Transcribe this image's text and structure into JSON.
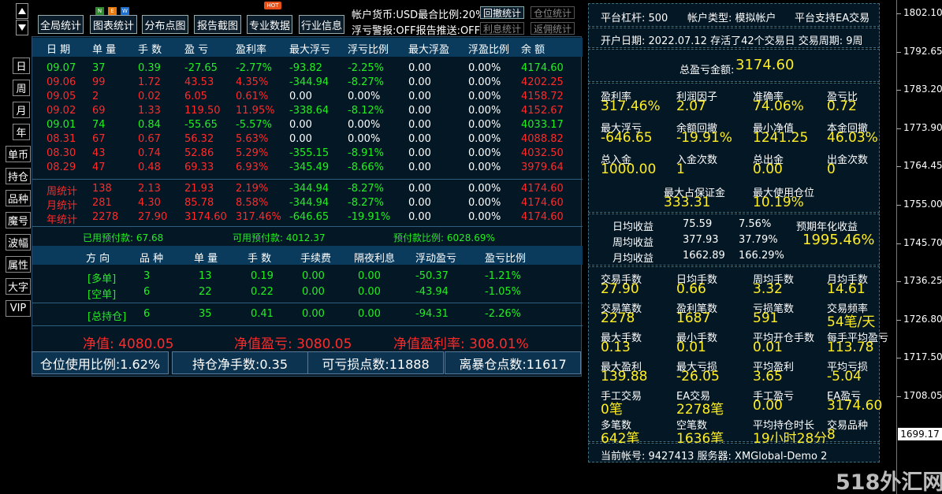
{
  "toolbar": {
    "buttons": [
      "全局统计",
      "图表统计",
      "分布点图",
      "报告截图",
      "专业数据",
      "行业信息"
    ],
    "badges": [
      "N",
      "E",
      "W"
    ],
    "hot": "HOT",
    "currency_label": "帐户货币:USD最合比例:20%",
    "float_warn_label": "浮亏警报:OFF报告推送:OFF",
    "small_buttons": [
      "回撤统计",
      "仓位统计",
      "利息统计",
      "返佣统计"
    ]
  },
  "side_buttons": [
    "日",
    "周",
    "月",
    "年",
    "单币",
    "持仓",
    "品种",
    "魔号",
    "波幅",
    "属性",
    "大字",
    "VIP"
  ],
  "table": {
    "headers": [
      "日 期",
      "单 量",
      "手 数",
      "盈 亏",
      "盈利率",
      "最大浮亏",
      "浮亏比例",
      "最大浮盈",
      "浮盈比例",
      "余 额"
    ],
    "rows": [
      {
        "date": "09.07",
        "qty": "37",
        "lots": "0.39",
        "pnl": "-27.65",
        "rate": "-2.77%",
        "maxloss": "-93.82",
        "lossratio": "-2.25%",
        "maxprofit": "0.00",
        "profitratio": "0.00%",
        "balance": "4174.60",
        "color": "green"
      },
      {
        "date": "09.06",
        "qty": "99",
        "lots": "1.72",
        "pnl": "43.53",
        "rate": "4.35%",
        "maxloss": "-344.94",
        "lossratio": "-8.27%",
        "maxprofit": "0.00",
        "profitratio": "0.00%",
        "balance": "4202.25",
        "color": "red"
      },
      {
        "date": "09.05",
        "qty": "2",
        "lots": "0.02",
        "pnl": "6.05",
        "rate": "0.61%",
        "maxloss": "0.00",
        "lossratio": "0.00%",
        "maxprofit": "0.00",
        "profitratio": "0.00%",
        "balance": "4158.72",
        "color": "red"
      },
      {
        "date": "09.02",
        "qty": "69",
        "lots": "1.33",
        "pnl": "119.50",
        "rate": "11.95%",
        "maxloss": "-338.64",
        "lossratio": "-8.12%",
        "maxprofit": "0.00",
        "profitratio": "0.00%",
        "balance": "4152.67",
        "color": "red"
      },
      {
        "date": "09.01",
        "qty": "74",
        "lots": "0.84",
        "pnl": "-55.65",
        "rate": "-5.57%",
        "maxloss": "0.00",
        "lossratio": "0.00%",
        "maxprofit": "0.00",
        "profitratio": "0.00%",
        "balance": "4033.17",
        "color": "green"
      },
      {
        "date": "08.31",
        "qty": "67",
        "lots": "0.67",
        "pnl": "56.32",
        "rate": "5.63%",
        "maxloss": "0.00",
        "lossratio": "0.00%",
        "maxprofit": "0.00",
        "profitratio": "0.00%",
        "balance": "4088.82",
        "color": "red"
      },
      {
        "date": "08.30",
        "qty": "43",
        "lots": "0.74",
        "pnl": "52.86",
        "rate": "5.29%",
        "maxloss": "-355.15",
        "lossratio": "-8.91%",
        "maxprofit": "0.00",
        "profitratio": "0.00%",
        "balance": "4032.50",
        "color": "red"
      },
      {
        "date": "08.29",
        "qty": "47",
        "lots": "0.48",
        "pnl": "69.33",
        "rate": "6.93%",
        "maxloss": "-345.49",
        "lossratio": "-8.66%",
        "maxprofit": "0.00",
        "profitratio": "0.00%",
        "balance": "3979.64",
        "color": "red"
      }
    ],
    "summary": [
      {
        "date": "周统计",
        "qty": "138",
        "lots": "2.13",
        "pnl": "21.93",
        "rate": "2.19%",
        "maxloss": "-344.94",
        "lossratio": "-8.27%",
        "maxprofit": "0.00",
        "profitratio": "0.00%",
        "balance": "4174.60"
      },
      {
        "date": "月统计",
        "qty": "281",
        "lots": "4.30",
        "pnl": "85.78",
        "rate": "8.58%",
        "maxloss": "-344.94",
        "lossratio": "-8.27%",
        "maxprofit": "0.00",
        "profitratio": "0.00%",
        "balance": "4174.60"
      },
      {
        "date": "年统计",
        "qty": "2278",
        "lots": "27.90",
        "pnl": "3174.60",
        "rate": "317.46%",
        "maxloss": "-646.65",
        "lossratio": "-19.91%",
        "maxprofit": "0.00",
        "profitratio": "0.00%",
        "balance": "4174.60"
      }
    ],
    "margin": {
      "used": "已用预付款: 67.68",
      "avail": "可用预付款: 4012.37",
      "ratio": "预付款比例: 6028.69%"
    },
    "pos_headers": [
      "方 向",
      "品 种",
      "单 量",
      "手 数",
      "手续费",
      "隔夜利息",
      "浮动盈亏",
      "盈亏比例"
    ],
    "positions": [
      {
        "dir": "[多单]",
        "sym": "3",
        "qty": "13",
        "lots": "0.19",
        "fee": "0.00",
        "swap": "0.00",
        "pnl": "-50.37",
        "ratio": "-1.21%"
      },
      {
        "dir": "[空单]",
        "sym": "6",
        "qty": "22",
        "lots": "0.22",
        "fee": "0.00",
        "swap": "0.00",
        "pnl": "-43.94",
        "ratio": "-1.05%"
      }
    ],
    "pos_total": {
      "dir": "[总持仓]",
      "sym": "6",
      "qty": "35",
      "lots": "0.41",
      "fee": "0.00",
      "swap": "0.00",
      "pnl": "-94.31",
      "ratio": "-2.26%"
    },
    "net": {
      "equity": "净值: 4080.05",
      "net_pnl": "净值盈亏: 3080.05",
      "net_rate": "净值盈利率: 308.01%"
    },
    "bottom": [
      "仓位使用比例:1.62%",
      "持仓净手数:0.35",
      "可亏损点数:11888",
      "离暴仓点数:11617"
    ]
  },
  "right": {
    "leverage": "平台杠杆: 500",
    "account_type": "帐户类型: 模拟帐户",
    "ea": "平台支持EA交易",
    "open_date": "开户日期: 2022.07.12 存活了42个交易日 交易周期: 9周",
    "total_pnl_label": "总盈亏金额:",
    "total_pnl_value": "3174.60",
    "grid1": [
      {
        "label": "盈利率",
        "value": "317.46%"
      },
      {
        "label": "利润因子",
        "value": "2.07"
      },
      {
        "label": "准确率",
        "value": "74.06%"
      },
      {
        "label": "盈亏比",
        "value": "0.72"
      },
      {
        "label": "最大浮亏",
        "value": "-646.65"
      },
      {
        "label": "余额回撤",
        "value": "-19.91%"
      },
      {
        "label": "最小净值",
        "value": "1241.25"
      },
      {
        "label": "本金回撤",
        "value": "46.03%"
      },
      {
        "label": "总入金",
        "value": "1000.00"
      },
      {
        "label": "入金次数",
        "value": "1"
      },
      {
        "label": "总出金",
        "value": "0.00"
      },
      {
        "label": "出金次数",
        "value": "0"
      }
    ],
    "max_margin": {
      "label": "最大占保证金",
      "value": "333.31"
    },
    "max_pos": {
      "label": "最大使用仓位",
      "value": "10.19%"
    },
    "income": [
      {
        "label": "日均收益",
        "value": "75.59",
        "pct": "7.56%"
      },
      {
        "label": "周均收益",
        "value": "377.93",
        "pct": "37.79%"
      },
      {
        "label": "月均收益",
        "value": "1662.89",
        "pct": "166.29%"
      }
    ],
    "annual": {
      "label": "预期年化收益",
      "value": "1995.46%"
    },
    "grid2": [
      {
        "label": "交易手数",
        "value": "27.90"
      },
      {
        "label": "日均手数",
        "value": "0.66"
      },
      {
        "label": "周均手数",
        "value": "3.32"
      },
      {
        "label": "月均手数",
        "value": "14.61"
      },
      {
        "label": "交易笔数",
        "value": "2278"
      },
      {
        "label": "盈利笔数",
        "value": "1687"
      },
      {
        "label": "亏损笔数",
        "value": "591"
      },
      {
        "label": "交易频率",
        "value": "54笔/天"
      },
      {
        "label": "最大手数",
        "value": "0.13"
      },
      {
        "label": "最小手数",
        "value": "0.01"
      },
      {
        "label": "平均开仓手数",
        "value": "0.01"
      },
      {
        "label": "每手平均盈亏",
        "value": "113.78"
      },
      {
        "label": "最大盈利",
        "value": "139.88"
      },
      {
        "label": "最大亏损",
        "value": "-26.05"
      },
      {
        "label": "平均盈利",
        "value": "3.65"
      },
      {
        "label": "平均亏损",
        "value": "-5.04"
      },
      {
        "label": "手工交易",
        "value": "0笔"
      },
      {
        "label": "EA交易",
        "value": "2278笔"
      },
      {
        "label": "手工盈亏",
        "value": "0.00"
      },
      {
        "label": "EA盈亏",
        "value": "3174.60"
      },
      {
        "label": "多笔数",
        "value": "642笔"
      },
      {
        "label": "空笔数",
        "value": "1636笔"
      },
      {
        "label": "平均持仓时长",
        "value": "19小时28分"
      },
      {
        "label": "交易品种",
        "value": "8"
      }
    ],
    "account": "当前帐号: 9427413 服务器: XMGlobal-Demo 2"
  },
  "price_axis": [
    "1802.10",
    "1792.65",
    "1783.20",
    "1773.90",
    "1764.45",
    "1755.00",
    "1745.70",
    "1736.25",
    "1726.80",
    "1717.50",
    "1708.05"
  ],
  "current_price": "1699.17",
  "watermark": "518外汇网"
}
